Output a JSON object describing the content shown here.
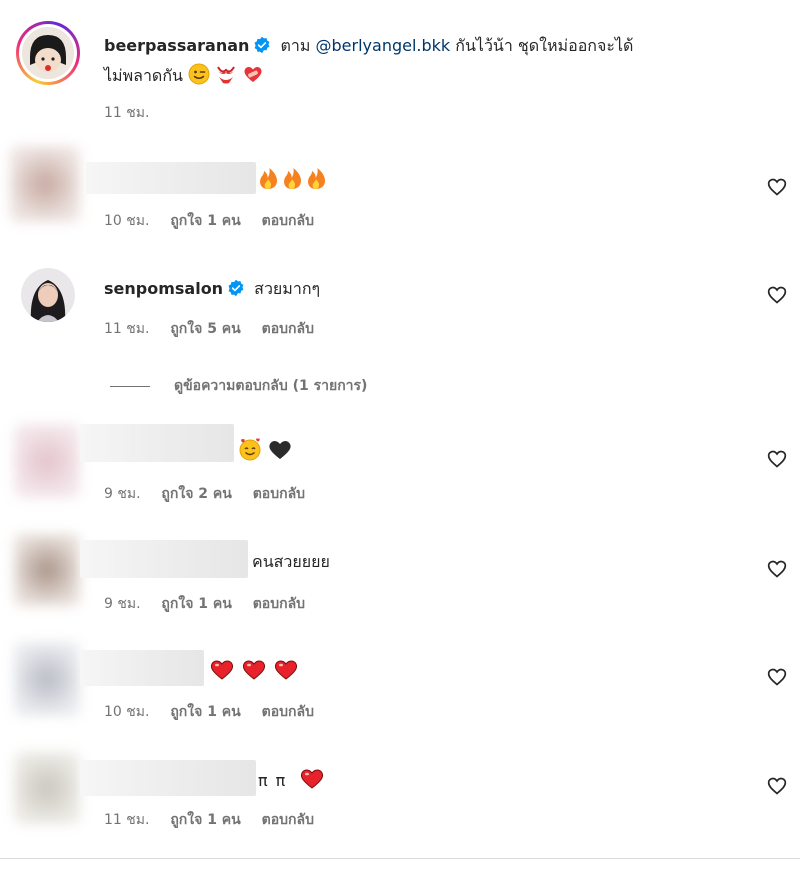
{
  "comments": [
    {
      "username": "beerpassaranan",
      "verified": true,
      "prefix": "ตาม",
      "mention": "@berlyangel.bkk",
      "text_line1": "กันไว้น้า ชุดใหม่ออกจะได้",
      "text_line2": "ไม่พลาดกัน",
      "time": "11 ชม."
    },
    {
      "text": "",
      "time": "10 ชม.",
      "likes": "ถูกใจ 1 คน",
      "reply": "ตอบกลับ"
    },
    {
      "username": "senpomsalon",
      "verified": true,
      "text": "สวยมากๆ",
      "time": "11 ชม.",
      "likes": "ถูกใจ 5 คน",
      "reply": "ตอบกลับ",
      "view_replies": "ดูข้อความตอบกลับ (1 รายการ)"
    },
    {
      "text": "",
      "time": "9 ชม.",
      "likes": "ถูกใจ 2 คน",
      "reply": "ตอบกลับ"
    },
    {
      "text": "คนสวยยยย",
      "time": "9 ชม.",
      "likes": "ถูกใจ 1 คน",
      "reply": "ตอบกลับ"
    },
    {
      "text": "",
      "time": "10 ชม.",
      "likes": "ถูกใจ 1 คน",
      "reply": "ตอบกลับ"
    },
    {
      "text": "ππ",
      "time": "11 ชม.",
      "likes": "ถูกใจ 1 คน",
      "reply": "ตอบกลับ"
    }
  ],
  "icons": {
    "like": "heart-outline-icon",
    "verified": "verified-badge-icon"
  },
  "colors": {
    "text": "#262626",
    "meta": "#737373",
    "mention": "#00376b",
    "verified": "#0095f6"
  }
}
